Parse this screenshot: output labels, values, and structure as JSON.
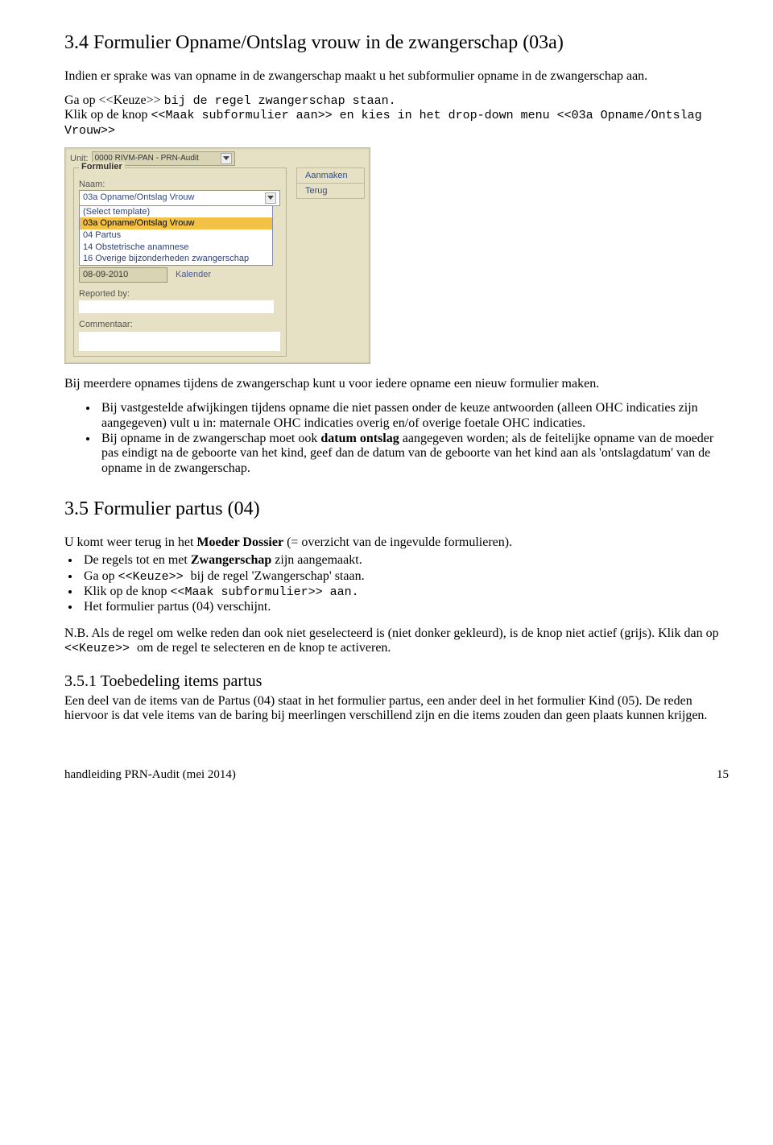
{
  "heading34": "3.4  Formulier Opname/Ontslag vrouw in de zwangerschap (03a)",
  "para34a": "Indien er sprake was van opname in de zwangerschap maakt u het subformulier opname in de zwangerschap aan.",
  "para34b_1": "Ga op <<Keuze>> ",
  "para34b_2": "bij de regel zwangerschap staan.",
  "para34c_1": "Klik op de knop ",
  "para34c_2": "<<Maak subformulier aan>> en kies in het drop-down menu <<03a Opname/Ontslag Vrouw>>",
  "shot": {
    "unitLabel": "Unit:",
    "unitValue": "0000 RIVM-PAN - PRN-Audit",
    "groupTitle": "Formulier",
    "naamLabel": "Naam:",
    "comboValue": "03a Opname/Ontslag Vrouw",
    "listItems": [
      "(Select template)",
      "03a Opname/Ontslag Vrouw",
      "04 Partus",
      "14 Obstetrische anamnese",
      "16 Overige bijzonderheden zwangerschap"
    ],
    "dateValue": "08-09-2010",
    "kalender": "Kalender",
    "reportedBy": "Reported by:",
    "commentaar": "Commentaar:",
    "btnAanmaken": "Aanmaken",
    "btnTerug": "Terug"
  },
  "para34d": "Bij meerdere opnames tijdens de zwangerschap kunt u voor iedere opname een nieuw formulier maken.",
  "bul34": [
    "Bij vastgestelde afwijkingen tijdens opname die niet passen onder de keuze antwoorden (alleen OHC indicaties zijn aangegeven) vult u in: maternale OHC indicaties overig en/of overige foetale OHC indicaties.",
    "Bij opname in de zwangerschap moet ook datum ontslag aangegeven worden; als de feitelijke opname van de moeder pas eindigt na de geboorte van het kind, geef dan de datum van de geboorte van het kind aan als 'ontslagdatum' van de opname in de zwangerschap."
  ],
  "bold_in_bul": "datum ontslag",
  "heading35": "3.5  Formulier partus (04)",
  "para35a_1": "U komt weer terug in het ",
  "para35a_2": "Moeder Dossier",
  "para35a_3": " (= overzicht van de ingevulde formulieren).",
  "bul35": [
    "De regels tot en met Zwangerschap zijn aangemaakt.",
    "Ga op <<Keuze>> bij de regel 'Zwangerschap' staan.",
    "Klik op de knop <<Maak subformulier>> aan.",
    "Het formulier partus (04) verschijnt."
  ],
  "bold_in_35_1": "Zwangerschap",
  "code_in_35_2a": "<<Keuze>> ",
  "code_in_35_3a": "<<Maak subformulier>> aan.",
  "para35b": "N.B. Als de regel om welke reden dan ook niet geselecteerd is (niet donker gekleurd), is de knop niet actief (grijs). Klik dan op <<Keuze>> om de regel te selecteren en de knop te activeren.",
  "code_in_35b": "<<Keuze>> ",
  "heading351": "3.5.1   Toebedeling items partus",
  "para351": "Een deel van de items van de Partus (04) staat in het formulier partus, een ander deel in het formulier Kind (05). De reden hiervoor is dat vele items van de baring bij meerlingen verschillend zijn en die items zouden dan geen plaats kunnen krijgen.",
  "footerLeft": "handleiding PRN-Audit (mei 2014)",
  "footerRight": "15"
}
